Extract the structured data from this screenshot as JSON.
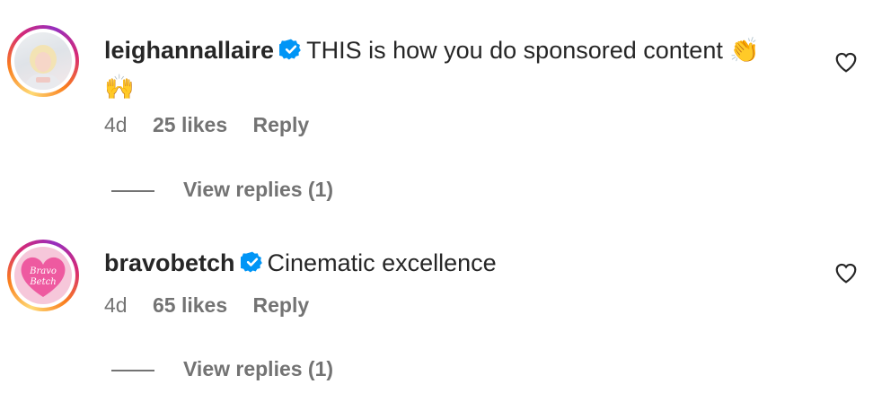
{
  "comments": [
    {
      "username": "leighannallaire",
      "verified": true,
      "text": "THIS is how you do sponsored content",
      "emoji_inline": "👏",
      "emoji_wrap": "🙌",
      "time": "4d",
      "likes": "25 likes",
      "reply": "Reply",
      "view_replies": "View replies (1)"
    },
    {
      "username": "bravobetch",
      "verified": true,
      "text": "Cinematic excellence",
      "avatar_text": "Bravo Betch",
      "time": "4d",
      "likes": "65 likes",
      "reply": "Reply",
      "view_replies": "View replies (1)"
    }
  ],
  "colors": {
    "verified_blue": "#0095f6",
    "muted_text": "#737373",
    "primary_text": "#262626",
    "bravo_pink": "#ee5aa0"
  }
}
